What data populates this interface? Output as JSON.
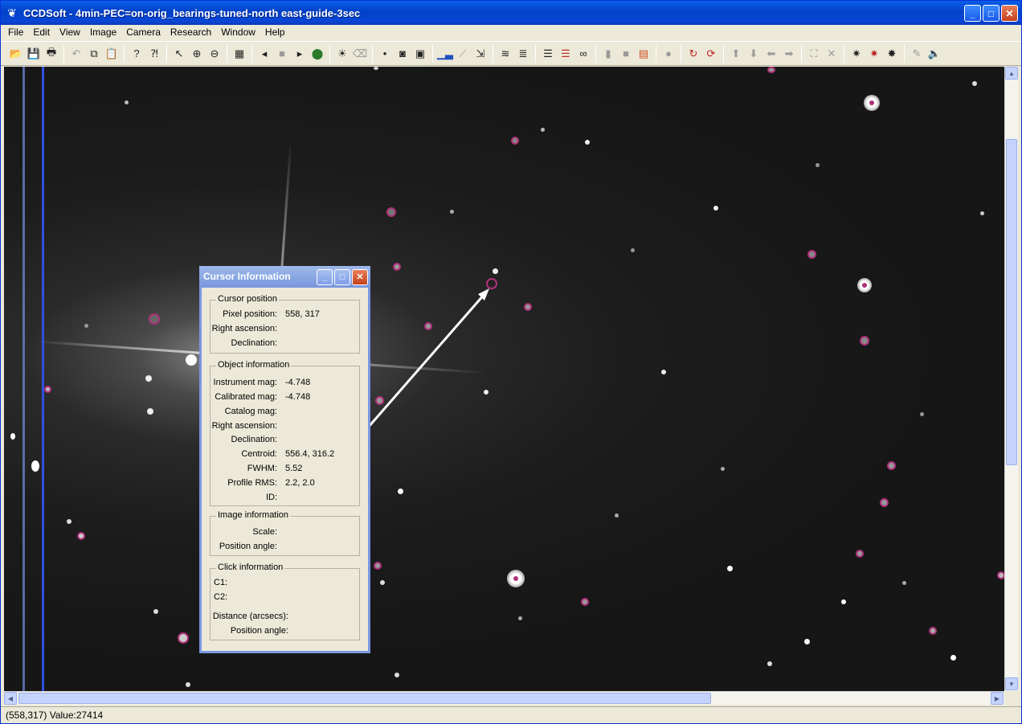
{
  "window": {
    "title": "CCDSoft  - 4min-PEC=on-orig_bearings-tuned-north east-guide-3sec",
    "minimize": "_",
    "maximize": "□",
    "close": "✕"
  },
  "menu": [
    "File",
    "Edit",
    "View",
    "Image",
    "Camera",
    "Research",
    "Window",
    "Help"
  ],
  "status": {
    "text": "(558,317) Value:27414"
  },
  "dialog": {
    "title": "Cursor Information",
    "cursor_position": {
      "heading": "Cursor position",
      "pixel_position_label": "Pixel position:",
      "pixel_position_value": "558, 317",
      "ra_label": "Right ascension:",
      "dec_label": "Declination:"
    },
    "object_information": {
      "heading": "Object information",
      "instrument_mag_label": "Instrument mag:",
      "instrument_mag_value": "-4.748",
      "calibrated_mag_label": "Calibrated mag:",
      "calibrated_mag_value": "-4.748",
      "catalog_mag_label": "Catalog mag:",
      "ra_label": "Right ascension:",
      "dec_label": "Declination:",
      "centroid_label": "Centroid:",
      "centroid_value": "556.4, 316.2",
      "fwhm_label": "FWHM:",
      "fwhm_value": "5.52",
      "profile_rms_label": "Profile RMS:",
      "profile_rms_value": "2.2, 2.0",
      "id_label": "ID:"
    },
    "image_information": {
      "heading": "Image information",
      "scale_label": "Scale:",
      "position_angle_label": "Position angle:"
    },
    "click_information": {
      "heading": "Click information",
      "c1_label": "C1:",
      "c2_label": "C2:",
      "distance_label": "Distance (arcsecs):",
      "position_angle_label": "Position angle:"
    }
  },
  "colors": {
    "title_gradient_top": "#0a5ee8",
    "dialog_title": "#7896dc",
    "marker_magenta": "#b0307a",
    "sky_background": "#1c1c1c"
  }
}
